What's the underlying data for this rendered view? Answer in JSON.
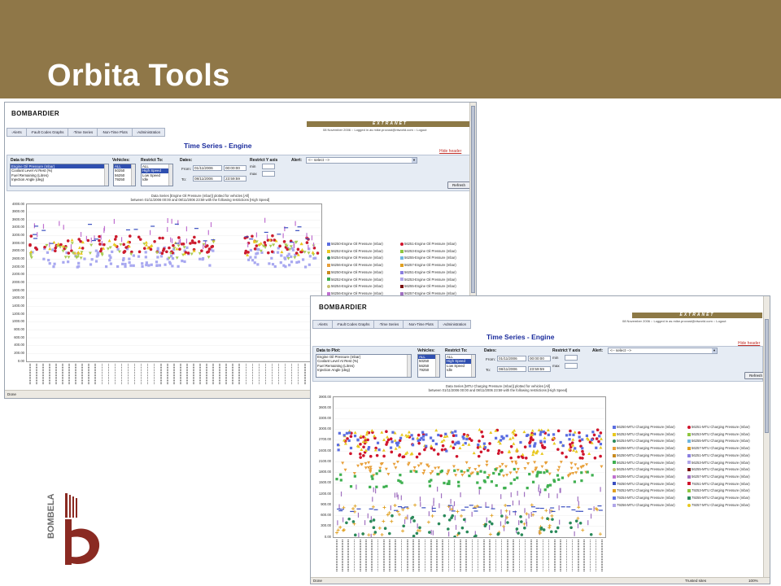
{
  "slide": {
    "title": "Orbita Tools",
    "colors": {
      "title_bar": "#8f7748",
      "logo_red": "#8a2a22",
      "logo_gray": "#6b6b6b"
    }
  },
  "logo": {
    "text": "BOMBELA"
  },
  "app": {
    "brand": "BOMBARDIER",
    "extranet": "EXTRANET",
    "login_info": "08 November 2006 :: Logged in as mike.provost@ntworld.com :: Logout",
    "tabs": [
      "Alerts",
      "Fault Codes Graphs",
      "Time Series",
      "Non-Time Plots",
      "Administration"
    ],
    "page_title": "Time Series - Engine",
    "hide_header": "Hide header",
    "form": {
      "data_to_plot_label": "Data to Plot:",
      "data_options": [
        "Engine Oil Pressure (mbar)",
        "Coolant Level At Rest (%)",
        "Fuel Remaining (Litres)",
        "Injection Angle (deg)"
      ],
      "vehicles_label": "Vehicles:",
      "vehicle_options": [
        "ALL",
        "50250",
        "56250",
        "79250"
      ],
      "restrict_label": "Restrict To:",
      "restrict_options": [
        "ALL",
        "High Speed",
        "Low Speed",
        "Idle"
      ],
      "dates_label": "Dates:",
      "from_label": "From:",
      "from_date": "01/11/2006",
      "from_time": "00:00:00",
      "to_label": "To:",
      "to_date": "08/11/2006",
      "to_time": "23:59:59",
      "restrict_y_label": "Restrict Y axis",
      "min_label": "min",
      "max_label": "max",
      "alert_label": "Alert:",
      "alert_value": "<-- select -->",
      "refresh_label": "Refresh"
    },
    "status_done": "Done",
    "trusted_sites": "Trusted sites",
    "zoom": "100%"
  },
  "chart_data": [
    {
      "type": "scatter",
      "title": "Data Series [Engine Oil Pressure (mbar)] plotted for vehicles [All]",
      "subtitle": "between 01/11/2006 00:00 and 08/11/2006 23:59 with the following restrictions [High Speed]",
      "ylim": [
        0,
        4000
      ],
      "yticks": [
        "4000.00",
        "3800.00",
        "3600.00",
        "3400.00",
        "3200.00",
        "3000.00",
        "2800.00",
        "2600.00",
        "2400.00",
        "2200.00",
        "2000.00",
        "1800.00",
        "1600.00",
        "1400.00",
        "1200.00",
        "1000.00",
        "800.00",
        "600.00",
        "400.00",
        "200.00",
        "0.00"
      ],
      "series": [
        {
          "name": "56250-Engine Oil Pressure (mbar)",
          "color": "#5b6ee1",
          "marker": "square"
        },
        {
          "name": "56251-Engine Oil Pressure (mbar)",
          "color": "#d0142c",
          "marker": "circle"
        },
        {
          "name": "56252-Engine Oil Pressure (mbar)",
          "color": "#e8c81e",
          "marker": "triangle"
        },
        {
          "name": "56253-Engine Oil Pressure (mbar)",
          "color": "#8ec63f",
          "marker": "diamond"
        },
        {
          "name": "56254-Engine Oil Pressure (mbar)",
          "color": "#2a8a5a",
          "marker": "circle"
        },
        {
          "name": "56255-Engine Oil Pressure (mbar)",
          "color": "#6fb7e0",
          "marker": "dash"
        },
        {
          "name": "56256-Engine Oil Pressure (mbar)",
          "color": "#e8a03a",
          "marker": "bar"
        },
        {
          "name": "56257-Engine Oil Pressure (mbar)",
          "color": "#e0a020",
          "marker": "plus"
        },
        {
          "name": "56250-Engine Oil Pressure (mbar)",
          "color": "#c88a1e",
          "marker": "tri-down"
        },
        {
          "name": "56251-Engine Oil Pressure (mbar)",
          "color": "#8a7ee0",
          "marker": "cross"
        },
        {
          "name": "56252-Engine Oil Pressure (mbar)",
          "color": "#3fb050",
          "marker": "square"
        },
        {
          "name": "56253-Engine Oil Pressure (mbar)",
          "color": "#b0a6e8",
          "marker": "square"
        },
        {
          "name": "56254-Engine Oil Pressure (mbar)",
          "color": "#c8c070",
          "marker": "circle"
        },
        {
          "name": "56255-Engine Oil Pressure (mbar)",
          "color": "#7a1010",
          "marker": "triangle"
        },
        {
          "name": "56256-Engine Oil Pressure (mbar)",
          "color": "#c070d0",
          "marker": "diamond"
        },
        {
          "name": "56257-Engine Oil Pressure (mbar)",
          "color": "#a070c0",
          "marker": "bar"
        }
      ],
      "clusters": [
        {
          "color": "#a8a8f0",
          "marker": "square",
          "ymin": 2400,
          "ymax": 2900,
          "n": 130
        },
        {
          "color": "#cc1c2e",
          "marker": "circle",
          "ymin": 2750,
          "ymax": 3200,
          "n": 110
        },
        {
          "color": "#aacc55",
          "marker": "tri-down",
          "ymin": 2600,
          "ymax": 3050,
          "n": 60
        },
        {
          "color": "#e8c81e",
          "marker": "triangle",
          "ymin": 2700,
          "ymax": 3100,
          "n": 40
        },
        {
          "color": "#c070d0",
          "marker": "bar",
          "ymin": 2900,
          "ymax": 3600,
          "n": 45
        },
        {
          "color": "#3a4fc0",
          "marker": "dash",
          "ymin": 3000,
          "ymax": 3500,
          "n": 25
        }
      ]
    },
    {
      "type": "scatter",
      "title": "Data Series [MTU Charging Pressure (mbar)] plotted for vehicles [All]",
      "subtitle": "between 01/11/2006 00:00 and 08/11/2006 23:59 with the following restrictions [High Speed]",
      "ylim": [
        0,
        3900
      ],
      "yticks": [
        "3900.00",
        "3600.00",
        "3300.00",
        "3000.00",
        "2700.00",
        "2400.00",
        "2100.00",
        "1800.00",
        "1500.00",
        "1200.00",
        "900.00",
        "600.00",
        "300.00",
        "0.00"
      ],
      "series": [
        {
          "name": "56250-MTU Charging Pressure (mbar)",
          "color": "#5b6ee1",
          "marker": "square"
        },
        {
          "name": "56251-MTU Charging Pressure (mbar)",
          "color": "#d0142c",
          "marker": "circle"
        },
        {
          "name": "56252-MTU Charging Pressure (mbar)",
          "color": "#e8c81e",
          "marker": "triangle"
        },
        {
          "name": "56253-MTU Charging Pressure (mbar)",
          "color": "#8ec63f",
          "marker": "diamond"
        },
        {
          "name": "56254-MTU Charging Pressure (mbar)",
          "color": "#2a8a5a",
          "marker": "circle"
        },
        {
          "name": "56255-MTU Charging Pressure (mbar)",
          "color": "#6fb7e0",
          "marker": "dash"
        },
        {
          "name": "56256-MTU Charging Pressure (mbar)",
          "color": "#e8a03a",
          "marker": "bar"
        },
        {
          "name": "56257-MTU Charging Pressure (mbar)",
          "color": "#e0a020",
          "marker": "plus"
        },
        {
          "name": "56250-MTU Charging Pressure (mbar)",
          "color": "#c88a1e",
          "marker": "tri-down"
        },
        {
          "name": "56251-MTU Charging Pressure (mbar)",
          "color": "#8a7ee0",
          "marker": "cross"
        },
        {
          "name": "56252-MTU Charging Pressure (mbar)",
          "color": "#3fb050",
          "marker": "square"
        },
        {
          "name": "56253-MTU Charging Pressure (mbar)",
          "color": "#b0a6e8",
          "marker": "square"
        },
        {
          "name": "56254-MTU Charging Pressure (mbar)",
          "color": "#c8c070",
          "marker": "circle"
        },
        {
          "name": "56255-MTU Charging Pressure (mbar)",
          "color": "#7a1010",
          "marker": "triangle"
        },
        {
          "name": "56256-MTU Charging Pressure (mbar)",
          "color": "#c070d0",
          "marker": "diamond"
        },
        {
          "name": "56257-MTU Charging Pressure (mbar)",
          "color": "#a070c0",
          "marker": "bar"
        },
        {
          "name": "79250-MTU Charging Pressure (mbar)",
          "color": "#3a4fc0",
          "marker": "dash"
        },
        {
          "name": "79251-MTU Charging Pressure (mbar)",
          "color": "#d0142c",
          "marker": "bar"
        },
        {
          "name": "79252-MTU Charging Pressure (mbar)",
          "color": "#e0a020",
          "marker": "plus"
        },
        {
          "name": "79253-MTU Charging Pressure (mbar)",
          "color": "#8ec63f",
          "marker": "tri-down"
        },
        {
          "name": "79254-MTU Charging Pressure (mbar)",
          "color": "#5b6ee1",
          "marker": "square"
        },
        {
          "name": "79255-MTU Charging Pressure (mbar)",
          "color": "#2a8a5a",
          "marker": "square"
        },
        {
          "name": "79256-MTU Charging Pressure (mbar)",
          "color": "#b0a6e8",
          "marker": "square"
        },
        {
          "name": "79257-MTU Charging Pressure (mbar)",
          "color": "#e8c81e",
          "marker": "circle"
        }
      ],
      "clusters": [
        {
          "color": "#d0142c",
          "marker": "circle",
          "ymin": 2200,
          "ymax": 3000,
          "n": 120
        },
        {
          "color": "#e8c81e",
          "marker": "triangle",
          "ymin": 2300,
          "ymax": 3000,
          "n": 100
        },
        {
          "color": "#5b6ee1",
          "marker": "square",
          "ymin": 2400,
          "ymax": 2950,
          "n": 90
        },
        {
          "color": "#e8a03a",
          "marker": "tri-down",
          "ymin": 1700,
          "ymax": 2100,
          "n": 100
        },
        {
          "color": "#3fb050",
          "marker": "square",
          "ymin": 1300,
          "ymax": 1900,
          "n": 80
        },
        {
          "color": "#a070c0",
          "marker": "bar",
          "ymin": 0,
          "ymax": 1400,
          "n": 90
        },
        {
          "color": "#e0a020",
          "marker": "plus",
          "ymin": 50,
          "ymax": 900,
          "n": 70
        },
        {
          "color": "#2a8a5a",
          "marker": "circle",
          "ymin": 0,
          "ymax": 600,
          "n": 60
        },
        {
          "color": "#3a4fc0",
          "marker": "dash",
          "ymin": 700,
          "ymax": 900,
          "n": 40
        }
      ]
    }
  ]
}
